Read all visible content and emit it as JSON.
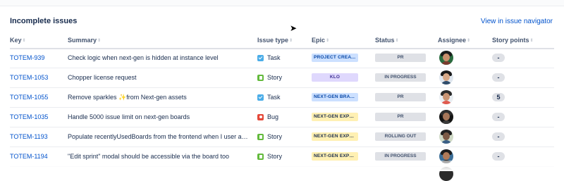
{
  "header": {
    "title": "Incomplete issues",
    "link": "View in issue navigator"
  },
  "columns": {
    "key": "Key",
    "summary": "Summary",
    "issue_type": "Issue type",
    "epic": "Epic",
    "status": "Status",
    "assignee": "Assignee",
    "story_points": "Story points"
  },
  "sort_glyph": "⇕",
  "rows": [
    {
      "key": "TOTEM-939",
      "summary": "Check logic when next-gen is hidden at instance level",
      "type": "Task",
      "type_icon": "task-icon",
      "epic": "PROJECT CREATE…",
      "epic_color": "#cce0ff",
      "epic_text": "#0747a6",
      "status": "PR",
      "points": "-"
    },
    {
      "key": "TOTEM-1053",
      "summary": "Chopper license request",
      "type": "Story",
      "type_icon": "story-icon",
      "epic": "KLO",
      "epic_color": "#dfd8fd",
      "epic_text": "#403294",
      "status": "IN PROGRESS",
      "points": "-"
    },
    {
      "key": "TOTEM-1055",
      "summary": "Remove sparkles ✨from Next-gen assets",
      "type": "Task",
      "type_icon": "task-icon",
      "epic": "NEXT-GEN BRAN…",
      "epic_color": "#cce0ff",
      "epic_text": "#0747a6",
      "status": "PR",
      "points": "5"
    },
    {
      "key": "TOTEM-1035",
      "summary": "Handle 5000 issue limit on next-gen boards",
      "type": "Bug",
      "type_icon": "bug-icon",
      "epic": "NEXT-GEN EXPER…",
      "epic_color": "#fff0b3",
      "epic_text": "#172b4d",
      "status": "PR",
      "points": "-"
    },
    {
      "key": "TOTEM-1193",
      "summary": "Populate recentlyUsedBoards from the frontend when I user acc…",
      "type": "Story",
      "type_icon": "story-icon",
      "epic": "NEXT-GEN EXPER…",
      "epic_color": "#fff0b3",
      "epic_text": "#172b4d",
      "status": "ROLLING OUT",
      "points": "-"
    },
    {
      "key": "TOTEM-1194",
      "summary": "\"Edit sprint\" modal should be accessible via the board too",
      "type": "Story",
      "type_icon": "story-icon",
      "epic": "NEXT-GEN EXPER…",
      "epic_color": "#fff0b3",
      "epic_text": "#172b4d",
      "status": "IN PROGRESS",
      "points": "-"
    }
  ],
  "avatars": [
    {
      "bg": "#2a6b3f",
      "hair": "#1b1b1b",
      "face": "#c98f6b",
      "body": "#7a3b2e"
    },
    {
      "bg": "#dfe6ee",
      "hair": "#1a1a1a",
      "face": "#d7a887",
      "body": "#2f4d6b"
    },
    {
      "bg": "#e9eef2",
      "hair": "#2b2b2b",
      "face": "#c99473",
      "body": "#e05a4f"
    },
    {
      "bg": "#141414",
      "hair": "#2d2d2d",
      "face": "#a67659",
      "body": "#3a3a3a"
    },
    {
      "bg": "#cfd9c6",
      "hair": "#222222",
      "face": "#7c5a45",
      "body": "#3a5f86"
    },
    {
      "bg": "#3d6f98",
      "hair": "#1d1d1d",
      "face": "#b07a58",
      "body": "#222222"
    }
  ]
}
